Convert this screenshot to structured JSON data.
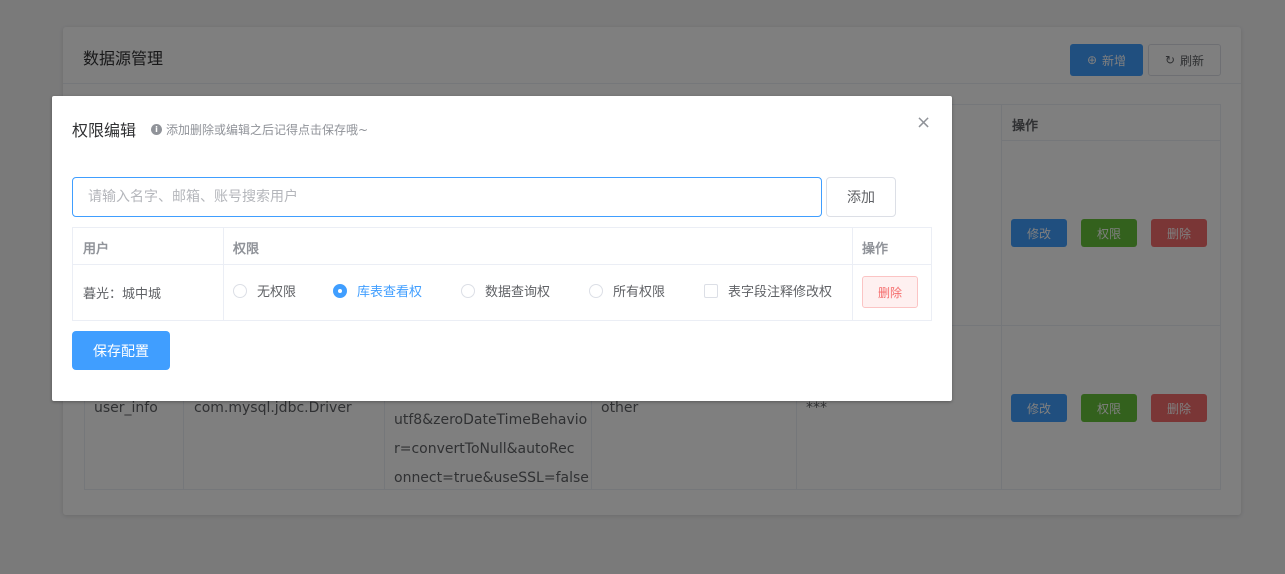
{
  "page": {
    "title": "数据源管理",
    "add_button": "新增",
    "refresh_button": "刷新",
    "table": {
      "ops_header": "操作",
      "rows": [
        {
          "edit": "修改",
          "perm": "权限",
          "del": "删除"
        },
        {
          "name": "user_info",
          "driver": "com.mysql.jdbc.Driver",
          "url_lines": [
            "utf8&zeroDateTimeBehavio",
            "r=convertToNull&autoRec",
            "onnect=true&useSSL=false"
          ],
          "type": "other",
          "password": "***",
          "edit": "修改",
          "perm": "权限",
          "del": "删除"
        }
      ]
    }
  },
  "dialog": {
    "title": "权限编辑",
    "hint": "添加删除或编辑之后记得点击保存哦~",
    "close": "×",
    "search_placeholder": "请输入名字、邮箱、账号搜索用户",
    "add_button": "添加",
    "table": {
      "headers": {
        "user": "用户",
        "perm": "权限",
        "ops": "操作"
      },
      "rows": [
        {
          "user": "暮光：城中城",
          "options": [
            "无权限",
            "库表查看权",
            "数据查询权",
            "所有权限"
          ],
          "selected": "库表查看权",
          "checkbox_label": "表字段注释修改权",
          "checkbox_checked": false,
          "delete": "删除"
        }
      ]
    },
    "save_button": "保存配置"
  },
  "colors": {
    "primary": "#409eff",
    "success": "#67c23a",
    "danger": "#f56c6c"
  }
}
